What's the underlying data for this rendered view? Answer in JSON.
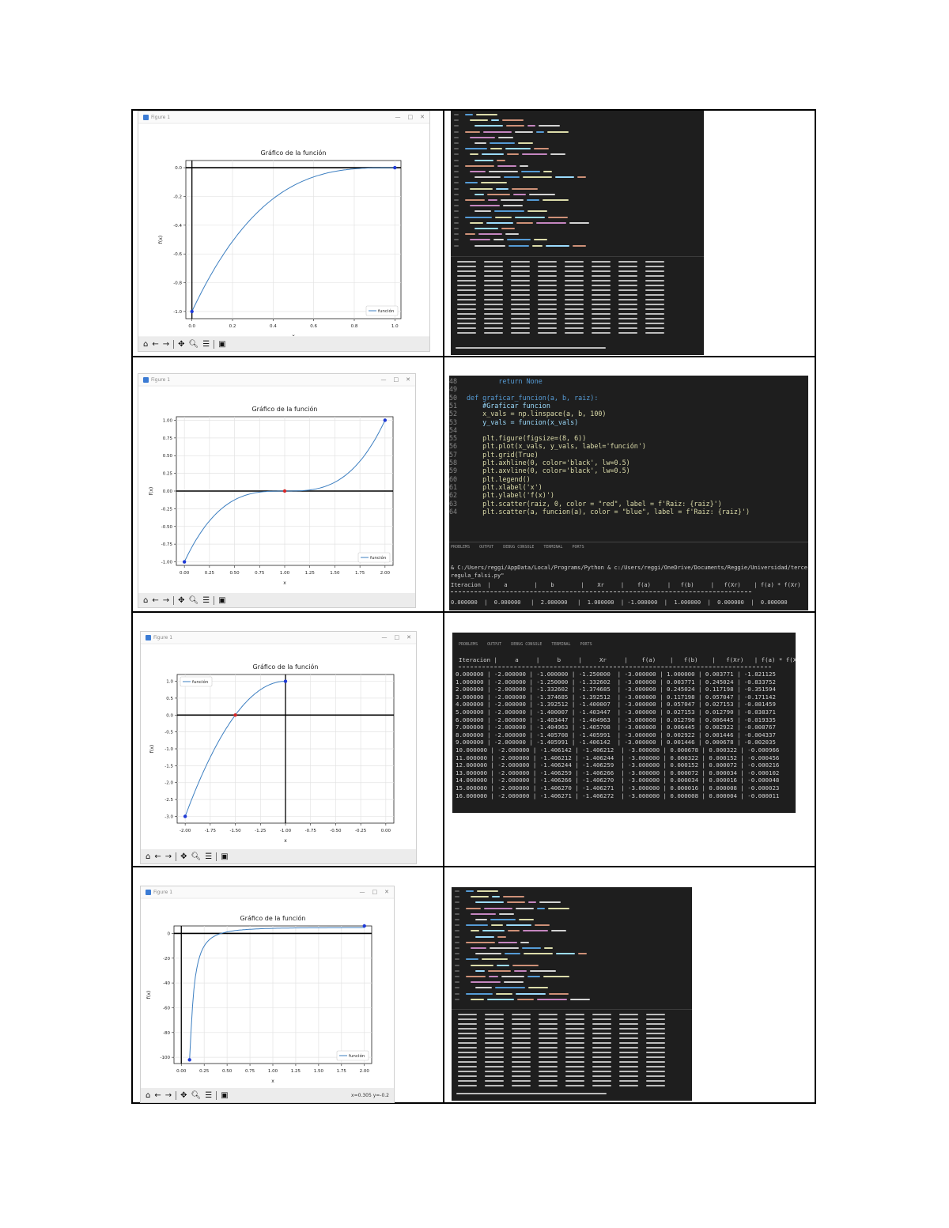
{
  "window": {
    "figure_title": "Figure 1"
  },
  "toolbar": {
    "status_text": "x=0.305 y=-0.2"
  },
  "plots": [
    {
      "title": "Gráfico de la función",
      "xlabel": "x",
      "ylabel": "f(x)",
      "legend": "función",
      "xticks": [
        "0.0",
        "0.2",
        "0.4",
        "0.6",
        "0.8",
        "1.0"
      ],
      "yticks": [
        "0.0",
        "-0.2",
        "-0.4",
        "-0.6",
        "-0.8",
        "-1.0"
      ]
    },
    {
      "title": "Gráfico de la función",
      "xlabel": "x",
      "ylabel": "f(x)",
      "legend": "función",
      "xticks": [
        "0.00",
        "0.25",
        "0.50",
        "0.75",
        "1.00",
        "1.25",
        "1.50",
        "1.75",
        "2.00"
      ],
      "yticks": [
        "1.00",
        "0.75",
        "0.50",
        "0.25",
        "0.00",
        "-0.25",
        "-0.50",
        "-0.75",
        "-1.00"
      ]
    },
    {
      "title": "Gráfico de la función",
      "xlabel": "x",
      "ylabel": "f(x)",
      "legend": "función",
      "xticks": [
        "-2.00",
        "-1.75",
        "-1.50",
        "-1.25",
        "-1.00",
        "-0.75",
        "-0.50",
        "-0.25",
        "0.00"
      ],
      "yticks": [
        "1.0",
        "0.5",
        "0.0",
        "-0.5",
        "-1.0",
        "-1.5",
        "-2.0",
        "-2.5",
        "-3.0"
      ]
    },
    {
      "title": "Gráfico de la función",
      "xlabel": "x",
      "ylabel": "f(x)",
      "legend": "función",
      "xticks": [
        "0.00",
        "0.25",
        "0.50",
        "0.75",
        "1.00",
        "1.25",
        "1.50",
        "1.75",
        "2.00"
      ],
      "yticks": [
        "0",
        "-20",
        "-40",
        "-60",
        "-80",
        "-100"
      ]
    }
  ],
  "code_panel_2": {
    "lines": [
      {
        "n": "48",
        "t": "        return None"
      },
      {
        "n": "49",
        "t": ""
      },
      {
        "n": "50",
        "t": "def graficar_funcion(a, b, raiz):"
      },
      {
        "n": "51",
        "t": "    #Graficar funcion"
      },
      {
        "n": "52",
        "t": "    x_vals = np.linspace(a, b, 100)"
      },
      {
        "n": "53",
        "t": "    y_vals = funcion(x_vals)"
      },
      {
        "n": "54",
        "t": ""
      },
      {
        "n": "55",
        "t": "    plt.figure(figsize=(8, 6))"
      },
      {
        "n": "56",
        "t": "    plt.plot(x_vals, y_vals, label='función')"
      },
      {
        "n": "57",
        "t": "    plt.grid(True)"
      },
      {
        "n": "58",
        "t": "    plt.axhline(0, color='black', lw=0.5)"
      },
      {
        "n": "59",
        "t": "    plt.axvline(0, color='black', lw=0.5)"
      },
      {
        "n": "60",
        "t": "    plt.legend()"
      },
      {
        "n": "61",
        "t": "    plt.xlabel('x')"
      },
      {
        "n": "62",
        "t": "    plt.ylabel('f(x)')"
      },
      {
        "n": "63",
        "t": "    plt.scatter(raiz, 0, color = \"red\", label = f'Raiz: {raiz}')"
      },
      {
        "n": "64",
        "t": "    plt.scatter(a, funcion(a), color = \"blue\", label = f'Raiz: {raiz}')"
      }
    ],
    "terminal_tabs": "PROBLEMS    OUTPUT    DEBUG CONSOLE    TERMINAL    PORTS",
    "cmd1": "& C:/Users/reggi/AppData/Local/Programs/Python & c:/Users/reggi/OneDrive/Documents/Reggie/Universidad/tercer año/metodos numericos/",
    "cmd2": "regula_falsi.py\"",
    "header": "Iteracion  |    a        |    b        |    Xr     |    f(a)     |   f(b)     |   f(Xr)    | f(a) * f(Xr)",
    "row": "0.000000  |  0.000000   |  2.000000   |  1.000000  | -1.000000  |  1.000000  |  0.000000  |  0.000000"
  },
  "table_panel_3": {
    "tabs": "PROBLEMS    OUTPUT    DEBUG CONSOLE    TERMINAL    PORTS",
    "header": "Iteracion |     a     |     b     |     Xr     |    f(a)    |   f(b)    |   f(Xr)   | f(a) * f(Xr)",
    "rows": [
      "0.000000 | -2.000000 | -1.000000 | -1.250000  | -3.000000 | 1.000000 | 0.003771 | -1.821125",
      "1.000000 | -2.000000 | -1.250000 | -1.332602  | -3.000000 | 0.003771 | 0.245024 | -0.833752",
      "2.000000 | -2.000000 | -1.332602 | -1.374685  | -3.000000 | 0.245024 | 0.117198 | -0.351594",
      "3.000000 | -2.000000 | -1.374685 | -1.392512  | -3.000000 | 0.117198 | 0.057047 | -0.171142",
      "4.000000 | -2.000000 | -1.392512 | -1.400007  | -3.000000 | 0.057047 | 0.027153 | -0.081459",
      "5.000000 | -2.000000 | -1.400007 | -1.403447  | -3.000000 | 0.027153 | 0.012790 | -0.038371",
      "6.000000 | -2.000000 | -1.403447 | -1.404963  | -3.000000 | 0.012790 | 0.006445 | -0.019335",
      "7.000000 | -2.000000 | -1.404963 | -1.405708  | -3.000000 | 0.006445 | 0.002922 | -0.008767",
      "8.000000 | -2.000000 | -1.405708 | -1.405991  | -3.000000 | 0.002922 | 0.001446 | -0.004337",
      "9.000000 | -2.000000 | -1.405991 | -1.406142  | -3.000000 | 0.001446 | 0.000678 | -0.002035",
      "10.000000 | -2.000000 | -1.406142 | -1.406212  | -3.000000 | 0.000678 | 0.000322 | -0.000966",
      "11.000000 | -2.000000 | -1.406212 | -1.406244  | -3.000000 | 0.000322 | 0.000152 | -0.000456",
      "12.000000 | -2.000000 | -1.406244 | -1.406259  | -3.000000 | 0.000152 | 0.000072 | -0.000216",
      "13.000000 | -2.000000 | -1.406259 | -1.406266  | -3.000000 | 0.000072 | 0.000034 | -0.000102",
      "14.000000 | -2.000000 | -1.406266 | -1.406270  | -3.000000 | 0.000034 | 0.000016 | -0.000048",
      "15.000000 | -2.000000 | -1.406270 | -1.406271  | -3.000000 | 0.000016 | 0.000008 | -0.000023",
      "16.000000 | -2.000000 | -1.406271 | -1.406272  | -3.000000 | 0.000008 | 0.000004 | -0.000011"
    ]
  },
  "colors": {
    "series": "#3d7fc1",
    "point_blue": "#1f3ad6",
    "point_red": "#d62728",
    "code_bg": "#1e1e1e"
  }
}
